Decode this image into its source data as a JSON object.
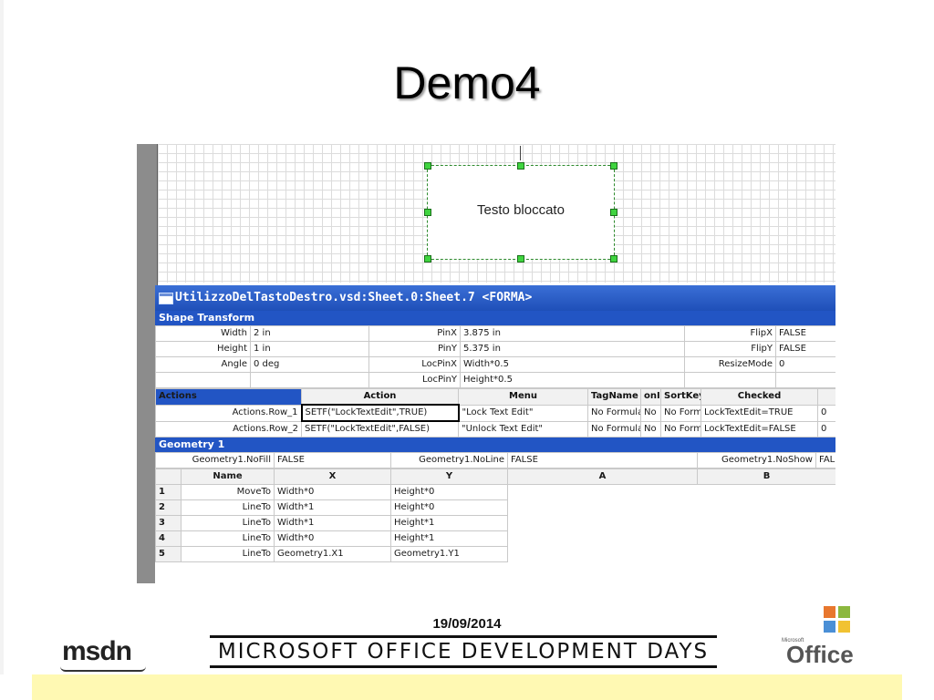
{
  "slide": {
    "title": "Demo4"
  },
  "drawing": {
    "shape_text": "Testo bloccato"
  },
  "shapesheet": {
    "window_title": "UtilizzoDelTastoDestro.vsd:Sheet.0:Sheet.7 <FORMA>",
    "shape_transform": {
      "section_title": "Shape Transform",
      "rows": [
        {
          "l1": "Width",
          "v1": "2 in",
          "l2": "PinX",
          "v2": "3.875 in",
          "l3": "FlipX",
          "v3": "FALSE"
        },
        {
          "l1": "Height",
          "v1": "1 in",
          "l2": "PinY",
          "v2": "5.375 in",
          "l3": "FlipY",
          "v3": "FALSE"
        },
        {
          "l1": "Angle",
          "v1": "0 deg",
          "l2": "LocPinX",
          "v2": "Width*0.5",
          "l3": "ResizeMode",
          "v3": "0"
        },
        {
          "l1": "",
          "v1": "",
          "l2": "LocPinY",
          "v2": "Height*0.5",
          "l3": "",
          "v3": ""
        }
      ]
    },
    "actions": {
      "section_title": "Actions",
      "columns": [
        "Action",
        "Menu",
        "TagName",
        "onI",
        "SortKey",
        "Checked"
      ],
      "rows": [
        {
          "name": "Actions.Row_1",
          "action": "SETF(\"LockTextEdit\",TRUE)",
          "menu": "\"Lock Text Edit\"",
          "tagname": "No Formula",
          "oni": "No",
          "sortkey": "No Form",
          "checked": "LockTextEdit=TRUE",
          "extra": "0"
        },
        {
          "name": "Actions.Row_2",
          "action": "SETF(\"LockTextEdit\",FALSE)",
          "menu": "\"Unlock Text Edit\"",
          "tagname": "No Formula",
          "oni": "No",
          "sortkey": "No Form",
          "checked": "LockTextEdit=FALSE",
          "extra": "0"
        }
      ]
    },
    "geometry": {
      "section_title": "Geometry 1",
      "flags": {
        "l1": "Geometry1.NoFill",
        "v1": "FALSE",
        "l2": "Geometry1.NoLine",
        "v2": "FALSE",
        "l3": "Geometry1.NoShow",
        "v3": "FAL"
      },
      "columns": [
        "Name",
        "X",
        "Y",
        "A",
        "B"
      ],
      "rows": [
        {
          "num": "1",
          "name": "MoveTo",
          "x": "Width*0",
          "y": "Height*0"
        },
        {
          "num": "2",
          "name": "LineTo",
          "x": "Width*1",
          "y": "Height*0"
        },
        {
          "num": "3",
          "name": "LineTo",
          "x": "Width*1",
          "y": "Height*1"
        },
        {
          "num": "4",
          "name": "LineTo",
          "x": "Width*0",
          "y": "Height*1"
        },
        {
          "num": "5",
          "name": "LineTo",
          "x": "Geometry1.X1",
          "y": "Geometry1.Y1"
        }
      ]
    }
  },
  "footer": {
    "date": "19/09/2014",
    "banner": "MICROSOFT OFFICE DEVELOPMENT DAYS",
    "msdn_logo": "msdn",
    "office_logo_small": "Microsoft",
    "office_logo": "Office"
  },
  "colors": {
    "section_blue": "#2255c4",
    "label_red": "#c0392b",
    "value_blue": "#1b1b8c",
    "handle_green": "#3fd43f",
    "footer_yellow": "#fff9b3"
  }
}
